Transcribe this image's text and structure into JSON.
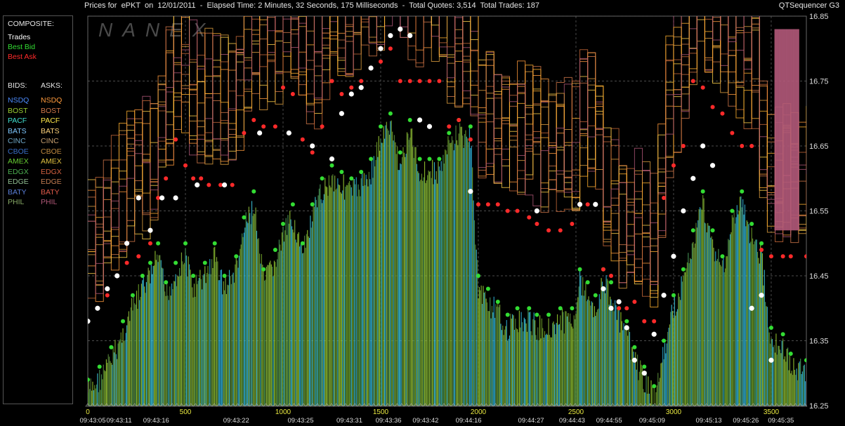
{
  "window": {
    "title": "Prices for  ePKT  on  12/01/2011  -  Elapsed Time: 2 Minutes, 32 Seconds, 175 Milliseconds  -  Total Quotes: 3,514  Total Trades: 187",
    "app_name": "QTSequencer G3",
    "watermark": "NANEX"
  },
  "legend": {
    "composite_label": "COMPOSITE:",
    "composite_items": [
      {
        "label": "Trades",
        "color": "#ffffff"
      },
      {
        "label": "Best Bid",
        "color": "#33dd33"
      },
      {
        "label": "Best Ask",
        "color": "#ff2a2a"
      }
    ],
    "bids_label": "BIDS:",
    "asks_label": "ASKS:",
    "exchanges": [
      {
        "bid": "NSDQ",
        "ask": "NSDQ",
        "bid_color": "#4c8cff",
        "ask_color": "#ff9a3c"
      },
      {
        "bid": "BOST",
        "ask": "BOST",
        "bid_color": "#9acd32",
        "ask_color": "#d2784a"
      },
      {
        "bid": "PACF",
        "ask": "PACF",
        "bid_color": "#40e0d0",
        "ask_color": "#ffe84a"
      },
      {
        "bid": "BATS",
        "ask": "BATS",
        "bid_color": "#7ec8ff",
        "ask_color": "#ffd27a"
      },
      {
        "bid": "CINC",
        "ask": "CINC",
        "bid_color": "#6fa8c8",
        "ask_color": "#c8a070"
      },
      {
        "bid": "CBOE",
        "ask": "CBOE",
        "bid_color": "#3a6fc8",
        "ask_color": "#c08a40"
      },
      {
        "bid": "AMEX",
        "ask": "AMEX",
        "bid_color": "#66cc33",
        "ask_color": "#e0c040"
      },
      {
        "bid": "EDGX",
        "ask": "EDGX",
        "bid_color": "#4caf50",
        "ask_color": "#d06040"
      },
      {
        "bid": "EDGE",
        "ask": "EDGE",
        "bid_color": "#8fbc8f",
        "ask_color": "#c07a50"
      },
      {
        "bid": "BATY",
        "ask": "BATY",
        "bid_color": "#5a7fd8",
        "ask_color": "#e05a4a"
      },
      {
        "bid": "PHIL",
        "ask": "PHIL",
        "bid_color": "#88aa66",
        "ask_color": "#b05878"
      }
    ]
  },
  "chart_data": {
    "type": "line",
    "ylim": [
      16.25,
      16.85
    ],
    "yticks": [
      "16.25",
      "16.35",
      "16.45",
      "16.55",
      "16.65",
      "16.75",
      "16.85"
    ],
    "xlim": [
      0,
      3680
    ],
    "xticks_sequence": [
      "0",
      "500",
      "1000",
      "1500",
      "2000",
      "2500",
      "3000",
      "3500"
    ],
    "xticks_time": [
      {
        "seq": 0,
        "label": "09:43:05"
      },
      {
        "seq": 160,
        "label": "09:43:11"
      },
      {
        "seq": 350,
        "label": "09:43:16"
      },
      {
        "seq": 760,
        "label": "09:43:22"
      },
      {
        "seq": 1090,
        "label": "09:43:25"
      },
      {
        "seq": 1340,
        "label": "09:43:31"
      },
      {
        "seq": 1540,
        "label": "09:43:36"
      },
      {
        "seq": 1730,
        "label": "09:43:42"
      },
      {
        "seq": 1950,
        "label": "09:44:16"
      },
      {
        "seq": 2270,
        "label": "09:44:27"
      },
      {
        "seq": 2480,
        "label": "09:44:43"
      },
      {
        "seq": 2670,
        "label": "09:44:55"
      },
      {
        "seq": 2890,
        "label": "09:45:09"
      },
      {
        "seq": 3180,
        "label": "09:45:13"
      },
      {
        "seq": 3370,
        "label": "09:45:26"
      },
      {
        "seq": 3550,
        "label": "09:45:35"
      }
    ],
    "series": [
      {
        "name": "Best Bid",
        "color": "#33dd33",
        "points": [
          [
            0,
            16.29
          ],
          [
            60,
            16.31
          ],
          [
            120,
            16.34
          ],
          [
            180,
            16.38
          ],
          [
            230,
            16.42
          ],
          [
            280,
            16.45
          ],
          [
            320,
            16.47
          ],
          [
            360,
            16.5
          ],
          [
            400,
            16.44
          ],
          [
            450,
            16.47
          ],
          [
            500,
            16.5
          ],
          [
            540,
            16.45
          ],
          [
            600,
            16.47
          ],
          [
            650,
            16.5
          ],
          [
            700,
            16.45
          ],
          [
            760,
            16.48
          ],
          [
            800,
            16.54
          ],
          [
            850,
            16.58
          ],
          [
            900,
            16.46
          ],
          [
            960,
            16.49
          ],
          [
            1000,
            16.53
          ],
          [
            1050,
            16.56
          ],
          [
            1100,
            16.5
          ],
          [
            1150,
            16.56
          ],
          [
            1200,
            16.6
          ],
          [
            1250,
            16.62
          ],
          [
            1300,
            16.61
          ],
          [
            1350,
            16.6
          ],
          [
            1400,
            16.61
          ],
          [
            1450,
            16.63
          ],
          [
            1500,
            16.68
          ],
          [
            1550,
            16.7
          ],
          [
            1600,
            16.64
          ],
          [
            1650,
            16.69
          ],
          [
            1700,
            16.63
          ],
          [
            1750,
            16.63
          ],
          [
            1800,
            16.63
          ],
          [
            1850,
            16.67
          ],
          [
            1900,
            16.69
          ],
          [
            1960,
            16.68
          ],
          [
            2000,
            16.45
          ],
          [
            2050,
            16.43
          ],
          [
            2100,
            16.41
          ],
          [
            2150,
            16.39
          ],
          [
            2200,
            16.4
          ],
          [
            2260,
            16.4
          ],
          [
            2300,
            16.39
          ],
          [
            2360,
            16.39
          ],
          [
            2420,
            16.4
          ],
          [
            2480,
            16.4
          ],
          [
            2520,
            16.46
          ],
          [
            2560,
            16.44
          ],
          [
            2600,
            16.42
          ],
          [
            2640,
            16.46
          ],
          [
            2680,
            16.44
          ],
          [
            2720,
            16.4
          ],
          [
            2760,
            16.38
          ],
          [
            2800,
            16.34
          ],
          [
            2850,
            16.31
          ],
          [
            2900,
            16.28
          ],
          [
            2950,
            16.35
          ],
          [
            3000,
            16.42
          ],
          [
            3050,
            16.46
          ],
          [
            3100,
            16.52
          ],
          [
            3150,
            16.58
          ],
          [
            3200,
            16.52
          ],
          [
            3250,
            16.48
          ],
          [
            3300,
            16.55
          ],
          [
            3350,
            16.58
          ],
          [
            3400,
            16.53
          ],
          [
            3450,
            16.5
          ],
          [
            3500,
            16.37
          ],
          [
            3560,
            16.36
          ],
          [
            3600,
            16.33
          ],
          [
            3680,
            16.32
          ]
        ]
      },
      {
        "name": "Best Ask",
        "color": "#ff2a2a",
        "points": [
          [
            100,
            16.42
          ],
          [
            150,
            16.45
          ],
          [
            200,
            16.47
          ],
          [
            260,
            16.48
          ],
          [
            320,
            16.5
          ],
          [
            360,
            16.57
          ],
          [
            400,
            16.6
          ],
          [
            450,
            16.66
          ],
          [
            500,
            16.62
          ],
          [
            540,
            16.6
          ],
          [
            580,
            16.6
          ],
          [
            620,
            16.59
          ],
          [
            680,
            16.59
          ],
          [
            740,
            16.59
          ],
          [
            800,
            16.67
          ],
          [
            850,
            16.69
          ],
          [
            900,
            16.68
          ],
          [
            960,
            16.68
          ],
          [
            1000,
            16.74
          ],
          [
            1050,
            16.73
          ],
          [
            1100,
            16.66
          ],
          [
            1150,
            16.64
          ],
          [
            1200,
            16.68
          ],
          [
            1250,
            16.75
          ],
          [
            1300,
            16.73
          ],
          [
            1350,
            16.74
          ],
          [
            1400,
            16.75
          ],
          [
            1450,
            16.77
          ],
          [
            1500,
            16.78
          ],
          [
            1550,
            16.8
          ],
          [
            1600,
            16.75
          ],
          [
            1650,
            16.75
          ],
          [
            1700,
            16.75
          ],
          [
            1750,
            16.75
          ],
          [
            1800,
            16.75
          ],
          [
            1850,
            16.68
          ],
          [
            1900,
            16.69
          ],
          [
            1960,
            16.66
          ],
          [
            2000,
            16.56
          ],
          [
            2050,
            16.56
          ],
          [
            2100,
            16.56
          ],
          [
            2150,
            16.55
          ],
          [
            2200,
            16.55
          ],
          [
            2260,
            16.54
          ],
          [
            2300,
            16.53
          ],
          [
            2360,
            16.52
          ],
          [
            2420,
            16.52
          ],
          [
            2480,
            16.53
          ],
          [
            2520,
            16.56
          ],
          [
            2560,
            16.56
          ],
          [
            2600,
            16.56
          ],
          [
            2640,
            16.46
          ],
          [
            2680,
            16.45
          ],
          [
            2720,
            16.4
          ],
          [
            2760,
            16.4
          ],
          [
            2800,
            16.41
          ],
          [
            2850,
            16.38
          ],
          [
            2900,
            16.38
          ],
          [
            2950,
            16.57
          ],
          [
            3000,
            16.62
          ],
          [
            3050,
            16.65
          ],
          [
            3100,
            16.75
          ],
          [
            3150,
            16.74
          ],
          [
            3200,
            16.71
          ],
          [
            3250,
            16.7
          ],
          [
            3300,
            16.67
          ],
          [
            3350,
            16.65
          ],
          [
            3400,
            16.65
          ],
          [
            3450,
            16.49
          ],
          [
            3500,
            16.48
          ],
          [
            3560,
            16.48
          ],
          [
            3600,
            16.48
          ],
          [
            3680,
            16.48
          ]
        ]
      },
      {
        "name": "Trades",
        "color": "#ffffff",
        "points": [
          [
            0,
            16.38
          ],
          [
            50,
            16.4
          ],
          [
            100,
            16.43
          ],
          [
            150,
            16.45
          ],
          [
            200,
            16.5
          ],
          [
            260,
            16.57
          ],
          [
            320,
            16.52
          ],
          [
            380,
            16.57
          ],
          [
            450,
            16.57
          ],
          [
            560,
            16.59
          ],
          [
            700,
            16.59
          ],
          [
            880,
            16.67
          ],
          [
            1030,
            16.67
          ],
          [
            1150,
            16.65
          ],
          [
            1250,
            16.63
          ],
          [
            1300,
            16.7
          ],
          [
            1350,
            16.73
          ],
          [
            1400,
            16.74
          ],
          [
            1450,
            16.77
          ],
          [
            1500,
            16.8
          ],
          [
            1550,
            16.82
          ],
          [
            1600,
            16.83
          ],
          [
            1650,
            16.82
          ],
          [
            1700,
            16.69
          ],
          [
            1750,
            16.68
          ],
          [
            1960,
            16.58
          ],
          [
            2300,
            16.55
          ],
          [
            2520,
            16.56
          ],
          [
            2600,
            16.56
          ],
          [
            2640,
            16.43
          ],
          [
            2680,
            16.4
          ],
          [
            2720,
            16.41
          ],
          [
            2760,
            16.37
          ],
          [
            2800,
            16.32
          ],
          [
            2850,
            16.3
          ],
          [
            2900,
            16.36
          ],
          [
            2950,
            16.42
          ],
          [
            3000,
            16.48
          ],
          [
            3050,
            16.55
          ],
          [
            3100,
            16.6
          ],
          [
            3150,
            16.65
          ],
          [
            3200,
            16.62
          ],
          [
            3400,
            16.4
          ],
          [
            3450,
            16.42
          ],
          [
            3500,
            16.32
          ]
        ]
      }
    ]
  }
}
